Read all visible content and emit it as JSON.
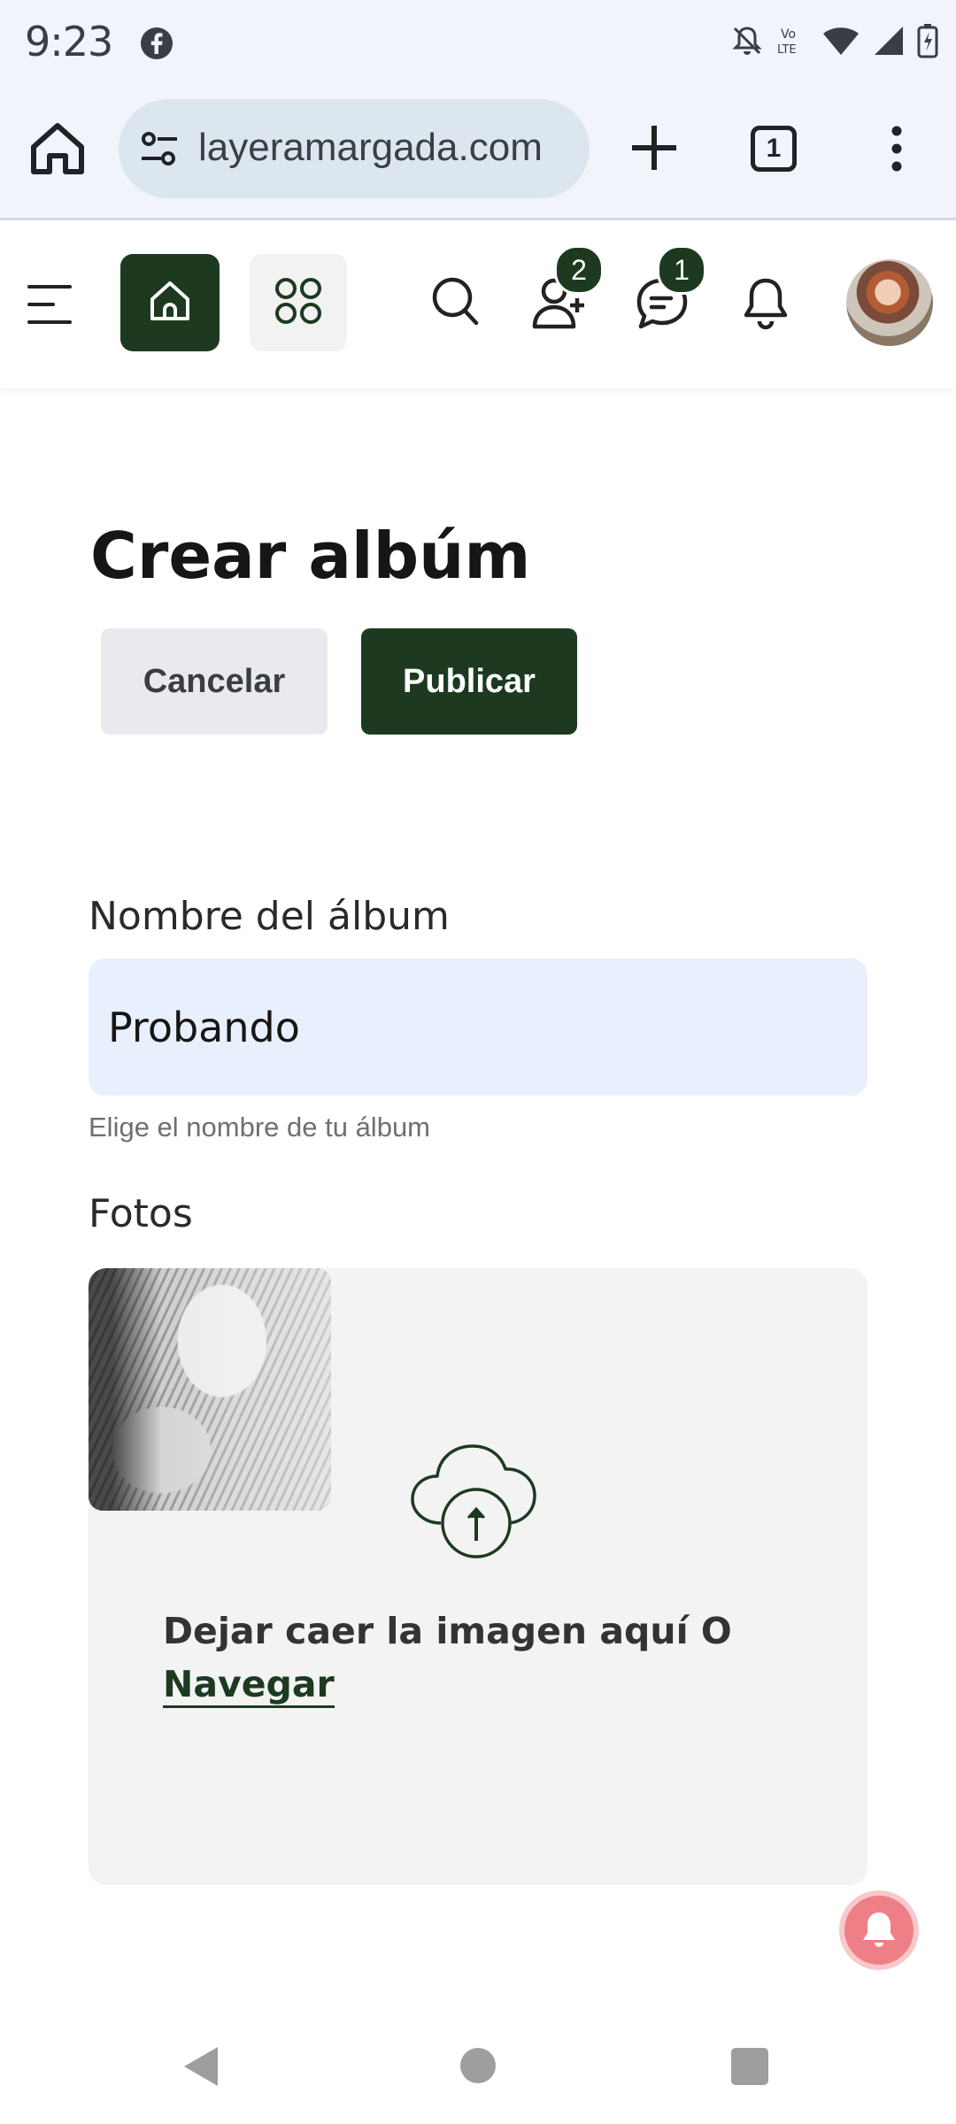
{
  "status_bar": {
    "time": "9:23",
    "icons": [
      "facebook-icon",
      "mute-icon",
      "volte-icon",
      "wifi-icon",
      "signal-icon",
      "battery-charging-icon"
    ]
  },
  "browser": {
    "url": "layeramargada.com",
    "tab_count": "1"
  },
  "header": {
    "friend_requests_count": "2",
    "messages_count": "1",
    "accent_color": "#1d3a20"
  },
  "page": {
    "title": "Crear albúm",
    "cancel_label": "Cancelar",
    "publish_label": "Publicar"
  },
  "form": {
    "album_name_label": "Nombre del álbum",
    "album_name_value": "Probando",
    "album_name_help": "Elige el nombre de tu álbum",
    "photos_label": "Fotos",
    "dropzone_text": "Dejar caer la imagen aquí O",
    "browse_link": "Navegar"
  }
}
